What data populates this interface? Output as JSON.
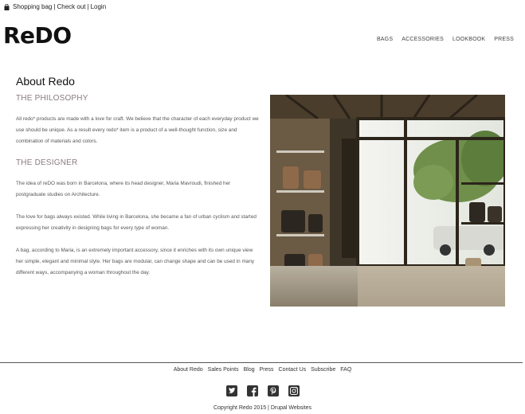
{
  "topbar": {
    "bag_icon": "shopping-bag-icon",
    "shopping_bag": "Shopping bag",
    "separator": "|",
    "checkout": "Check out",
    "login": "Login"
  },
  "logo": "ReDO",
  "nav": [
    "BAGS",
    "ACCESSORIES",
    "LOOKBOOK",
    "PRESS"
  ],
  "main": {
    "title": "About Redo",
    "philosophy_heading": "THE PHILOSOPHY",
    "philosophy_text": "All redo* products are made with a love for craft. We believe that the character of each everyday product we use should be unique. As a result every redo* item is a product of a well-thought function, size and combination of materials and colors.",
    "designer_heading": "THE DESIGNER",
    "designer_p1": "The idea of reDO was born in Barcelona, where its head designer, Maria Mavroudi, finished her postgraduate studies on Architecture.",
    "designer_p2": "The love for bags always existed. While living in Barcelona, she became a fan of urban cyclism and started expressing her creativity in designing bags for every type of woman.",
    "designer_p3": "A bag, according to Maria, is an extremely important accessory, since it enriches with its own unique view her simple, elegant and minimal style. Her bags are modular, can change shape and can be used in many different ways, accompanying a woman throughout the day."
  },
  "footer": {
    "links": [
      "About Redo",
      "Sales Points",
      "Blog",
      "Press",
      "Contact Us",
      "Subscribe",
      "FAQ"
    ],
    "social": [
      "twitter-icon",
      "facebook-icon",
      "pinterest-icon",
      "instagram-icon"
    ],
    "copyright": "Copyright Redo 2015 | Drupal Websites"
  },
  "colors": {
    "heading_accent": "#8a7a7e",
    "body_text": "#555555",
    "social_icon": "#333333"
  }
}
